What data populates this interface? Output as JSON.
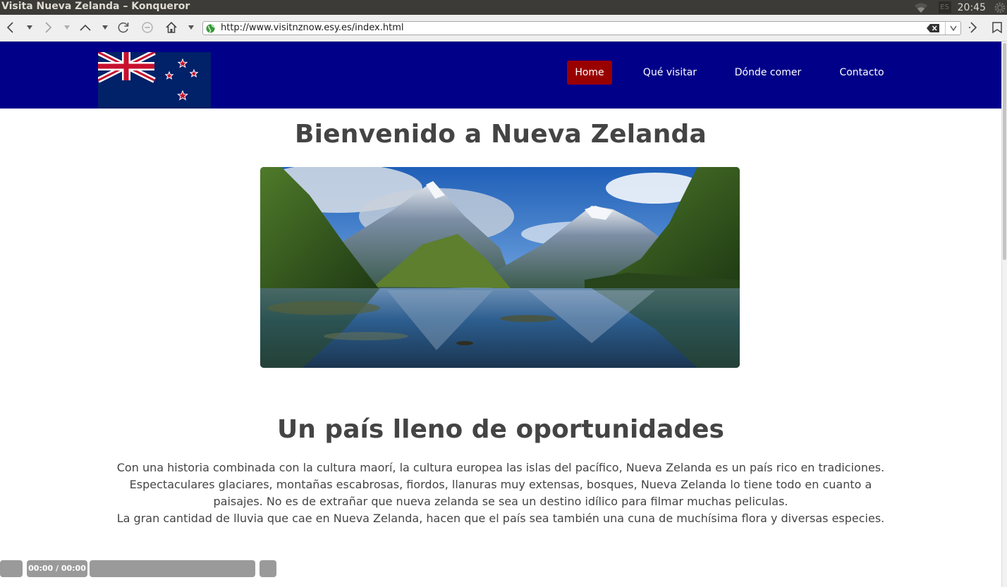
{
  "window": {
    "title": "Visita Nueva Zelanda – Konqueror",
    "keyboard_indicator": "ES",
    "clock": "20:45"
  },
  "toolbar": {
    "url": "http://www.visitnznow.esy.es/index.html",
    "buttons": [
      "back-icon",
      "history-dropdown-icon",
      "forward-icon",
      "up-icon",
      "reload-icon",
      "stop-icon",
      "home-icon",
      "location-dropdown-icon",
      "more-icon",
      "bookmark-icon"
    ]
  },
  "site": {
    "colors": {
      "nav_bg": "#000088",
      "nav_active": "#990000",
      "text": "#444444"
    },
    "nav": [
      {
        "label": "Home",
        "active": true
      },
      {
        "label": "Qué visitar",
        "active": false
      },
      {
        "label": "Dónde comer",
        "active": false
      },
      {
        "label": "Contacto",
        "active": false
      }
    ],
    "heading": "Bienvenido a Nueva Zelanda",
    "subheading": "Un país lleno de oportunidades",
    "paragraph": [
      "Con una historia combinada con la cultura maorí, la cultura europea las islas del pacífico, Nueva Zelanda es un país rico en tradiciones.",
      "Espectaculares glaciares, montañas escabrosas, fiordos, llanuras muy extensas, bosques, Nueva Zelanda lo tiene todo en cuanto a paisajes. No es de extrañar que nueva zelanda se sea un destino idílico para filmar muchas peliculas.",
      "La gran cantidad de lluvia que cae en Nueva Zelanda, hacen que el país sea también una cuna de muchísima flora y diversas especies."
    ]
  },
  "player": {
    "time": "00:00 / 00:00"
  }
}
